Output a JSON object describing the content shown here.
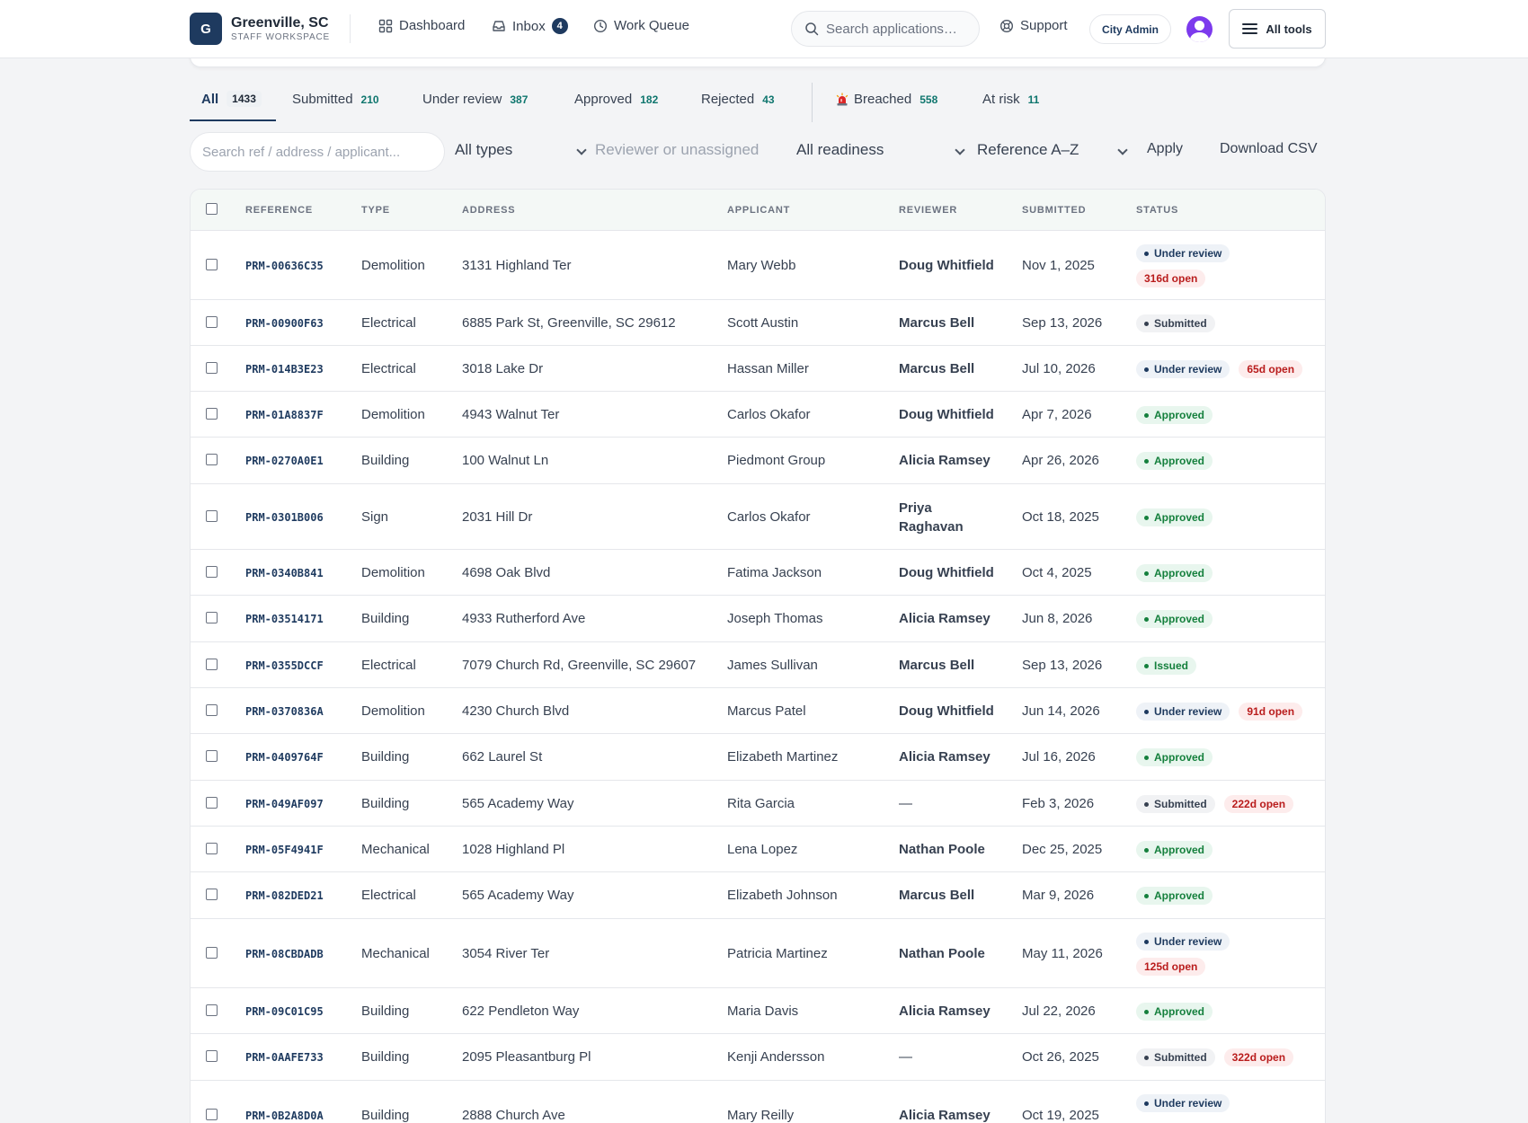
{
  "brand": {
    "logo_letter": "G",
    "name": "Greenville, SC",
    "subtitle": "STAFF WORKSPACE"
  },
  "nav": {
    "dashboard": "Dashboard",
    "inbox": "Inbox",
    "inbox_count": "4",
    "work_queue": "Work Queue"
  },
  "header": {
    "search_placeholder": "Search applications…",
    "support": "Support",
    "role": "City Admin",
    "all_tools": "All tools"
  },
  "tabs": [
    {
      "label": "All",
      "count": "1433"
    },
    {
      "label": "Submitted",
      "count": "210"
    },
    {
      "label": "Under review",
      "count": "387"
    },
    {
      "label": "Approved",
      "count": "182"
    },
    {
      "label": "Rejected",
      "count": "43"
    },
    {
      "label": "Breached",
      "count": "558",
      "icon": "siren-icon"
    },
    {
      "label": "At risk",
      "count": "11"
    }
  ],
  "filters": {
    "search_placeholder": "Search ref / address / applicant...",
    "type": "All types",
    "reviewer_placeholder": "Reviewer or unassigned",
    "readiness": "All readiness",
    "sort": "Reference A–Z",
    "apply": "Apply",
    "download": "Download CSV"
  },
  "table": {
    "headers": {
      "reference": "Reference",
      "type": "Type",
      "address": "Address",
      "applicant": "Applicant",
      "reviewer": "Reviewer",
      "submitted": "Submitted",
      "status": "Status"
    },
    "rows": [
      {
        "ref": "PRM-00636C35",
        "type": "Demolition",
        "address": "3131 Highland Ter",
        "applicant": "Mary Webb",
        "reviewer": "Doug Whitfield",
        "submitted": "Nov 1, 2025",
        "status": "Under review",
        "status_kind": "review",
        "open": "316d open"
      },
      {
        "ref": "PRM-00900F63",
        "type": "Electrical",
        "address": "6885 Park St, Greenville, SC 29612",
        "applicant": "Scott Austin",
        "reviewer": "Marcus Bell",
        "submitted": "Sep 13, 2026",
        "status": "Submitted",
        "status_kind": "submitted",
        "open": ""
      },
      {
        "ref": "PRM-014B3E23",
        "type": "Electrical",
        "address": "3018 Lake Dr",
        "applicant": "Hassan Miller",
        "reviewer": "Marcus Bell",
        "submitted": "Jul 10, 2026",
        "status": "Under review",
        "status_kind": "review",
        "open": "65d open"
      },
      {
        "ref": "PRM-01A8837F",
        "type": "Demolition",
        "address": "4943 Walnut Ter",
        "applicant": "Carlos Okafor",
        "reviewer": "Doug Whitfield",
        "submitted": "Apr 7, 2026",
        "status": "Approved",
        "status_kind": "approved",
        "open": ""
      },
      {
        "ref": "PRM-0270A0E1",
        "type": "Building",
        "address": "100 Walnut Ln",
        "applicant": "Piedmont Group",
        "reviewer": "Alicia Ramsey",
        "submitted": "Apr 26, 2026",
        "status": "Approved",
        "status_kind": "approved",
        "open": ""
      },
      {
        "ref": "PRM-0301B006",
        "type": "Sign",
        "address": "2031 Hill Dr",
        "applicant": "Carlos Okafor",
        "reviewer": "Priya Raghavan",
        "submitted": "Oct 18, 2025",
        "status": "Approved",
        "status_kind": "approved",
        "open": ""
      },
      {
        "ref": "PRM-0340B841",
        "type": "Demolition",
        "address": "4698 Oak Blvd",
        "applicant": "Fatima Jackson",
        "reviewer": "Doug Whitfield",
        "submitted": "Oct 4, 2025",
        "status": "Approved",
        "status_kind": "approved",
        "open": ""
      },
      {
        "ref": "PRM-03514171",
        "type": "Building",
        "address": "4933 Rutherford Ave",
        "applicant": "Joseph Thomas",
        "reviewer": "Alicia Ramsey",
        "submitted": "Jun 8, 2026",
        "status": "Approved",
        "status_kind": "approved",
        "open": ""
      },
      {
        "ref": "PRM-0355DCCF",
        "type": "Electrical",
        "address": "7079 Church Rd, Greenville, SC 29607",
        "applicant": "James Sullivan",
        "reviewer": "Marcus Bell",
        "submitted": "Sep 13, 2026",
        "status": "Issued",
        "status_kind": "issued",
        "open": ""
      },
      {
        "ref": "PRM-0370836A",
        "type": "Demolition",
        "address": "4230 Church Blvd",
        "applicant": "Marcus Patel",
        "reviewer": "Doug Whitfield",
        "submitted": "Jun 14, 2026",
        "status": "Under review",
        "status_kind": "review",
        "open": "91d open"
      },
      {
        "ref": "PRM-0409764F",
        "type": "Building",
        "address": "662 Laurel St",
        "applicant": "Elizabeth Martinez",
        "reviewer": "Alicia Ramsey",
        "submitted": "Jul 16, 2026",
        "status": "Approved",
        "status_kind": "approved",
        "open": ""
      },
      {
        "ref": "PRM-049AF097",
        "type": "Building",
        "address": "565 Academy Way",
        "applicant": "Rita Garcia",
        "reviewer": "—",
        "submitted": "Feb 3, 2026",
        "status": "Submitted",
        "status_kind": "submitted",
        "open": "222d open"
      },
      {
        "ref": "PRM-05F4941F",
        "type": "Mechanical",
        "address": "1028 Highland Pl",
        "applicant": "Lena Lopez",
        "reviewer": "Nathan Poole",
        "submitted": "Dec 25, 2025",
        "status": "Approved",
        "status_kind": "approved",
        "open": ""
      },
      {
        "ref": "PRM-082DED21",
        "type": "Electrical",
        "address": "565 Academy Way",
        "applicant": "Elizabeth Johnson",
        "reviewer": "Marcus Bell",
        "submitted": "Mar 9, 2026",
        "status": "Approved",
        "status_kind": "approved",
        "open": ""
      },
      {
        "ref": "PRM-08CBDADB",
        "type": "Mechanical",
        "address": "3054 River Ter",
        "applicant": "Patricia Martinez",
        "reviewer": "Nathan Poole",
        "submitted": "May 11, 2026",
        "status": "Under review",
        "status_kind": "review",
        "open": "125d open"
      },
      {
        "ref": "PRM-09C01C95",
        "type": "Building",
        "address": "622 Pendleton Way",
        "applicant": "Maria Davis",
        "reviewer": "Alicia Ramsey",
        "submitted": "Jul 22, 2026",
        "status": "Approved",
        "status_kind": "approved",
        "open": ""
      },
      {
        "ref": "PRM-0AAFE733",
        "type": "Building",
        "address": "2095 Pleasantburg Pl",
        "applicant": "Kenji Andersson",
        "reviewer": "—",
        "submitted": "Oct 26, 2025",
        "status": "Submitted",
        "status_kind": "submitted",
        "open": "322d open"
      },
      {
        "ref": "PRM-0B2A8D0A",
        "type": "Building",
        "address": "2888 Church Ave",
        "applicant": "Mary Reilly",
        "reviewer": "Alicia Ramsey",
        "submitted": "Oct 19, 2025",
        "status": "Under review",
        "status_kind": "review",
        "open": ""
      }
    ]
  }
}
